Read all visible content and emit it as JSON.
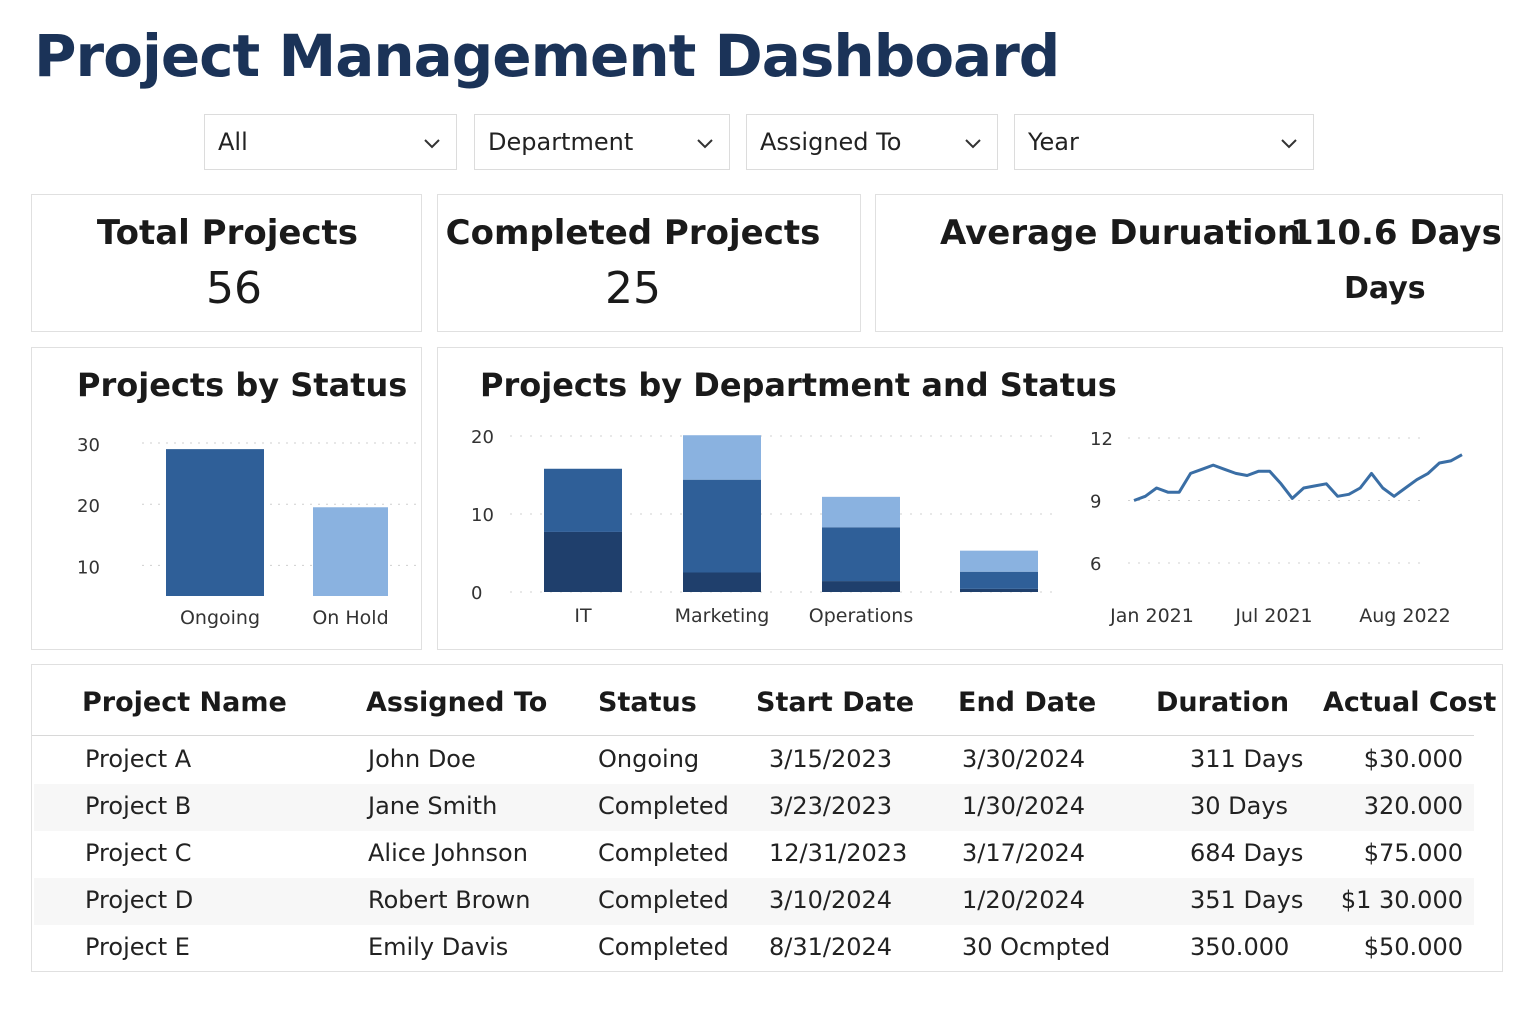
{
  "page": {
    "title": "Project Management Dashboard"
  },
  "filters": [
    {
      "label": "All"
    },
    {
      "label": "Department"
    },
    {
      "label": "Assigned To"
    },
    {
      "label": "Year"
    }
  ],
  "kpis": {
    "total": {
      "label": "Total Projects",
      "value": "56"
    },
    "completed": {
      "label": "Completed Projects",
      "value": "25"
    },
    "average": {
      "label": "Average Duruation",
      "value": "110.6 Days",
      "unit": "Days"
    }
  },
  "colors": {
    "dark": "#1f3f6c",
    "mid": "#2f5f98",
    "light": "#8ab2e0",
    "line": "#3a6ea5",
    "title": "#1b3358"
  },
  "chart_data": [
    {
      "type": "bar",
      "title": "Projects by Status",
      "categories": [
        "Ongoing",
        "On Hold"
      ],
      "values": [
        29,
        19.5
      ],
      "colors": [
        "#2f5f98",
        "#8ab2e0"
      ],
      "yticks": [
        "30",
        "20",
        "10"
      ],
      "ylim": [
        5,
        30
      ],
      "grid": true
    },
    {
      "type": "bar",
      "stacked": true,
      "title": "Projects by Department and Status",
      "categories": [
        "IT",
        "Marketing",
        "Operations",
        ""
      ],
      "series": [
        {
          "values": [
            7.7,
            2.5,
            1.4,
            0.4
          ],
          "color": "#1f3f6c"
        },
        {
          "values": [
            8.1,
            11.9,
            6.9,
            2.2
          ],
          "color": "#2f5f98"
        },
        {
          "values": [
            0,
            5.7,
            3.9,
            2.7
          ],
          "color": "#8ab2e0"
        }
      ],
      "yticks": [
        "20",
        "10",
        "0"
      ],
      "ylim": [
        0,
        20
      ],
      "grid": true
    },
    {
      "type": "line",
      "title": "",
      "xticks": [
        "Jan 2021",
        "Jul 2021",
        "Aug 2022"
      ],
      "yticks": [
        "12",
        "9",
        "6"
      ],
      "ylim": [
        6,
        12
      ],
      "values": [
        9.0,
        9.2,
        9.6,
        9.4,
        9.4,
        10.3,
        10.5,
        10.7,
        10.5,
        10.3,
        10.2,
        10.4,
        10.4,
        9.8,
        9.1,
        9.6,
        9.7,
        9.8,
        9.2,
        9.3,
        9.6,
        10.3,
        9.6,
        9.2,
        9.6,
        10.0,
        10.3,
        10.8,
        10.9,
        11.2
      ],
      "color": "#3a6ea5",
      "grid": true
    }
  ],
  "table": {
    "headers": [
      "Project Name",
      "Assigned To",
      "Status",
      "Start Date",
      "End Date",
      "Duration",
      "Actual Cost"
    ],
    "rows": [
      [
        "Project A",
        "John Doe",
        "Ongoing",
        "3/15/2023",
        "3/30/2024",
        "311 Days",
        "$30.000"
      ],
      [
        "Project B",
        "Jane Smith",
        "Completed",
        "3/23/2023",
        "1/30/2024",
        "30 Days",
        "320.000"
      ],
      [
        "Project C",
        "Alice Johnson",
        "Completed",
        "12/31/2023",
        "3/17/2024",
        "684 Days",
        "$75.000"
      ],
      [
        "Project D",
        "Robert Brown",
        "Completed",
        "3/10/2024",
        "1/20/2024",
        "351 Days",
        "$1 30.000"
      ],
      [
        "Project E",
        "Emily Davis",
        "Completed",
        "8/31/2024",
        "30 Ocmpted",
        "350.000",
        "$50.000"
      ]
    ]
  }
}
